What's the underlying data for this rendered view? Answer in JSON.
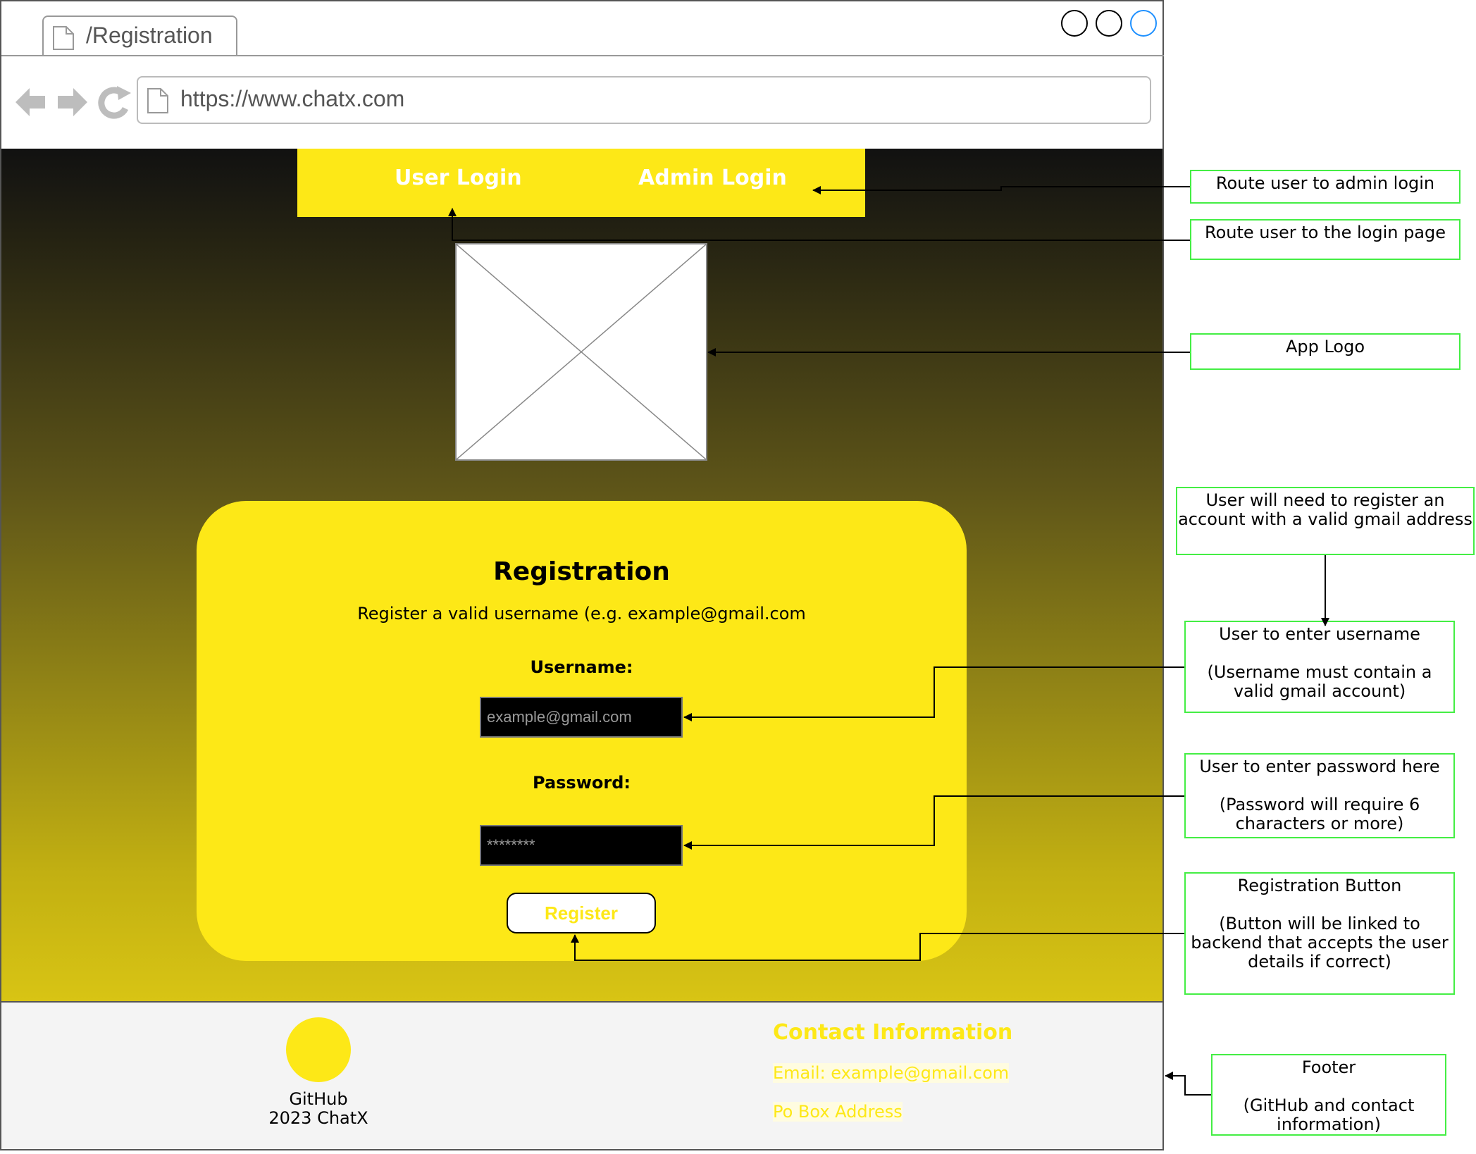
{
  "browser": {
    "tab_title": "/Registration",
    "url": "https://www.chatx.com"
  },
  "nav": {
    "user_login": "User Login",
    "admin_login": "Admin Login"
  },
  "registration": {
    "title": "Registration",
    "subtitle": "Register a valid username (e.g. example@gmail.com",
    "username_label": "Username:",
    "username_placeholder": "example@gmail.com",
    "password_label": "Password:",
    "password_placeholder": "********",
    "register_button": "Register"
  },
  "footer": {
    "github_label": "GitHub",
    "copyright": "2023 ChatX",
    "contact_title": "Contact Information",
    "email": "Email: example@gmail.com",
    "address": "Po Box Address"
  },
  "annotations": {
    "admin_login": "Route user to admin login",
    "login_page": "Route user to the login page",
    "app_logo": "App Logo",
    "gmail_requirement": "User will need to register an account with a valid gmail address",
    "username_line1": "User to enter username",
    "username_line2": "(Username must contain a valid gmail account)",
    "password_line1": "User to enter password here",
    "password_line2": "(Password will require 6 characters or more)",
    "register_line1": "Registration Button",
    "register_line2": "(Button will be linked to backend that accepts the user details if correct)",
    "footer_line1": "Footer",
    "footer_line2": "(GitHub and contact information)"
  },
  "colors": {
    "accent_yellow": "#fde817",
    "annotation_border": "#44ee44",
    "window_button_highlight": "#1e90ff"
  },
  "icons": [
    "page-icon",
    "back-arrow-icon",
    "forward-arrow-icon",
    "refresh-icon",
    "image-placeholder-icon"
  ]
}
